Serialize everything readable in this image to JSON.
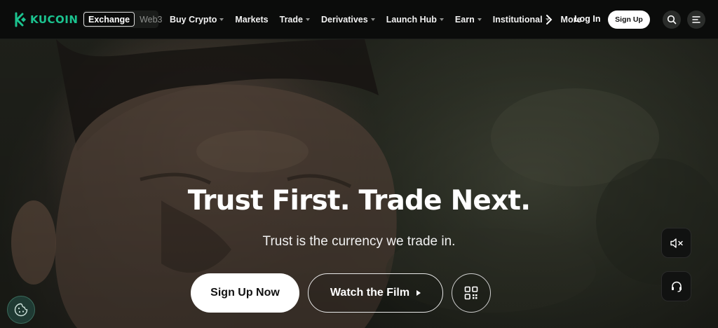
{
  "brand": {
    "name": "KUCOIN",
    "color": "#1bc38f",
    "icon": "kucoin-logo-icon"
  },
  "mode_switch": {
    "active": "Exchange",
    "inactive": "Web3"
  },
  "menu": [
    {
      "label": "Buy Crypto",
      "dropdown": true
    },
    {
      "label": "Markets",
      "dropdown": false
    },
    {
      "label": "Trade",
      "dropdown": true
    },
    {
      "label": "Derivatives",
      "dropdown": true
    },
    {
      "label": "Launch Hub",
      "dropdown": true
    },
    {
      "label": "Earn",
      "dropdown": true
    },
    {
      "label": "Institutional",
      "dropdown": true
    },
    {
      "label": "More",
      "dropdown": false
    }
  ],
  "header_actions": {
    "login": "Log In",
    "signup": "Sign Up",
    "search_icon": "search-icon",
    "menu_icon": "hamburger-icon"
  },
  "hero": {
    "title": "Trust First. Trade Next.",
    "subtitle": "Trust is the currency we trade in.",
    "primary_cta": "Sign Up Now",
    "secondary_cta": "Watch the Film",
    "qr_icon": "qr-code-icon"
  },
  "floating": {
    "mute_icon": "mute-icon",
    "support_icon": "headset-icon",
    "cookie_icon": "cookie-icon"
  }
}
